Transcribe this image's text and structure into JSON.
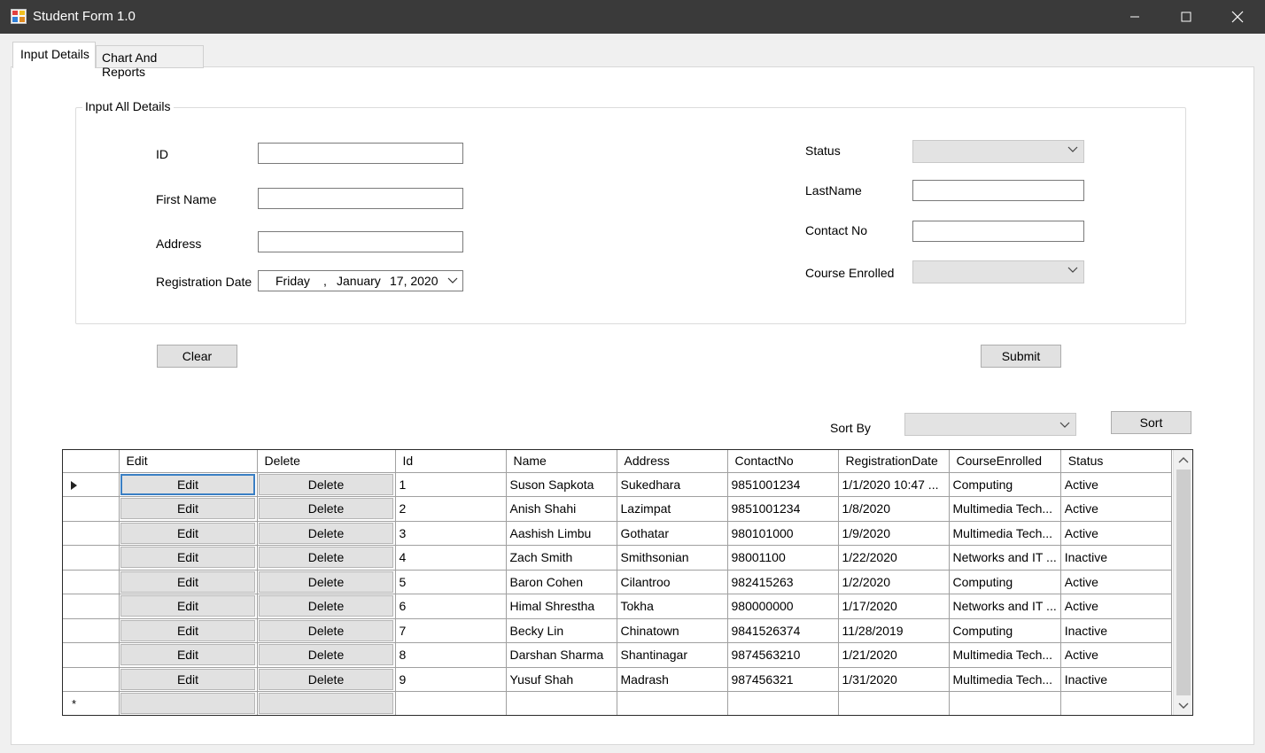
{
  "window": {
    "title": "Student Form 1.0"
  },
  "tabs": [
    {
      "label": "Input Details",
      "active": true
    },
    {
      "label": "Chart And Reports",
      "active": false
    }
  ],
  "form": {
    "group_title": "Input All Details",
    "id_label": "ID",
    "id_value": "",
    "first_name_label": "First Name",
    "first_name_value": "",
    "address_label": "Address",
    "address_value": "",
    "reg_date_label": "Registration Date",
    "reg_date": {
      "weekday": "Friday",
      "sep": ",",
      "month": "January",
      "day_year": "17, 2020"
    },
    "status_label": "Status",
    "status_value": "",
    "last_name_label": "LastName",
    "last_name_value": "",
    "contact_label": "Contact No",
    "contact_value": "",
    "course_label": "Course Enrolled",
    "course_value": ""
  },
  "buttons": {
    "clear": "Clear",
    "submit": "Submit",
    "sort": "Sort"
  },
  "sort": {
    "label": "Sort By",
    "value": ""
  },
  "grid": {
    "columns": [
      "Edit",
      "Delete",
      "Id",
      "Name",
      "Address",
      "ContactNo",
      "RegistrationDate",
      "CourseEnrolled",
      "Status"
    ],
    "edit_label": "Edit",
    "delete_label": "Delete",
    "new_row_marker": "*",
    "rows": [
      {
        "id": "1",
        "name": "Suson Sapkota",
        "address": "Sukedhara",
        "contact": "9851001234",
        "reg_date": "1/1/2020 10:47 ...",
        "course": "Computing",
        "status": "Active"
      },
      {
        "id": "2",
        "name": "Anish Shahi",
        "address": "Lazimpat",
        "contact": "9851001234",
        "reg_date": "1/8/2020",
        "course": "Multimedia Tech...",
        "status": "Active"
      },
      {
        "id": "3",
        "name": "Aashish Limbu",
        "address": "Gothatar",
        "contact": "980101000",
        "reg_date": "1/9/2020",
        "course": "Multimedia Tech...",
        "status": "Active"
      },
      {
        "id": "4",
        "name": "Zach Smith",
        "address": "Smithsonian",
        "contact": "98001100",
        "reg_date": "1/22/2020",
        "course": "Networks and IT ...",
        "status": "Inactive"
      },
      {
        "id": "5",
        "name": "Baron Cohen",
        "address": "Cilantroo",
        "contact": "982415263",
        "reg_date": "1/2/2020",
        "course": "Computing",
        "status": "Active"
      },
      {
        "id": "6",
        "name": "Himal Shrestha",
        "address": "Tokha",
        "contact": "980000000",
        "reg_date": "1/17/2020",
        "course": "Networks and IT ...",
        "status": "Active"
      },
      {
        "id": "7",
        "name": "Becky Lin",
        "address": "Chinatown",
        "contact": "9841526374",
        "reg_date": "11/28/2019",
        "course": "Computing",
        "status": "Inactive"
      },
      {
        "id": "8",
        "name": "Darshan Sharma",
        "address": "Shantinagar",
        "contact": "9874563210",
        "reg_date": "1/21/2020",
        "course": "Multimedia Tech...",
        "status": "Active"
      },
      {
        "id": "9",
        "name": "Yusuf Shah",
        "address": "Madrash",
        "contact": "987456321",
        "reg_date": "1/31/2020",
        "course": "Multimedia Tech...",
        "status": "Inactive"
      }
    ]
  }
}
